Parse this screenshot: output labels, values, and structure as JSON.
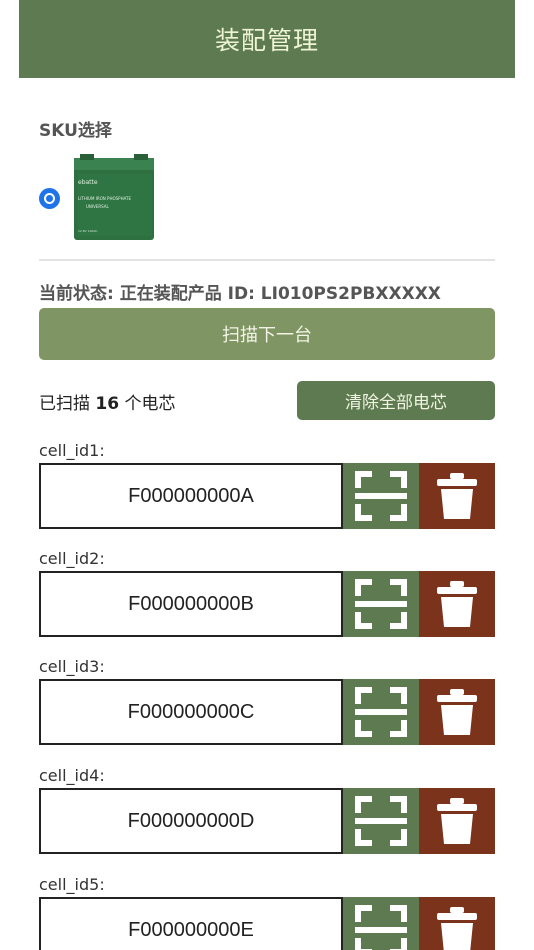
{
  "header": {
    "title": "装配管理"
  },
  "sku": {
    "label": "SKU选择",
    "product_image": {
      "brand": "ebatte",
      "line1": "LITHIUM IRON PHOSPHATE",
      "line2": "UNIVERSAL",
      "line3": "12.8V 100Ah"
    }
  },
  "status": {
    "text": "当前状态: 正在装配产品 ID: LI010PS2PBXXXXX"
  },
  "scan_next_button": {
    "label": "扫描下一台"
  },
  "scanned": {
    "prefix": "已扫描",
    "count": "16",
    "suffix": "个电芯"
  },
  "clear_all_button": {
    "label": "清除全部电芯"
  },
  "cells": [
    {
      "label": "cell_id1:",
      "value": "F000000000A"
    },
    {
      "label": "cell_id2:",
      "value": "F000000000B"
    },
    {
      "label": "cell_id3:",
      "value": "F000000000C"
    },
    {
      "label": "cell_id4:",
      "value": "F000000000D"
    },
    {
      "label": "cell_id5:",
      "value": "F000000000E"
    }
  ],
  "colors": {
    "header": "#5e7a50",
    "scan_button": "#5e7a50",
    "delete_button": "#7b331c",
    "primary_button": "#7f9563",
    "radio": "#1f73e8"
  }
}
